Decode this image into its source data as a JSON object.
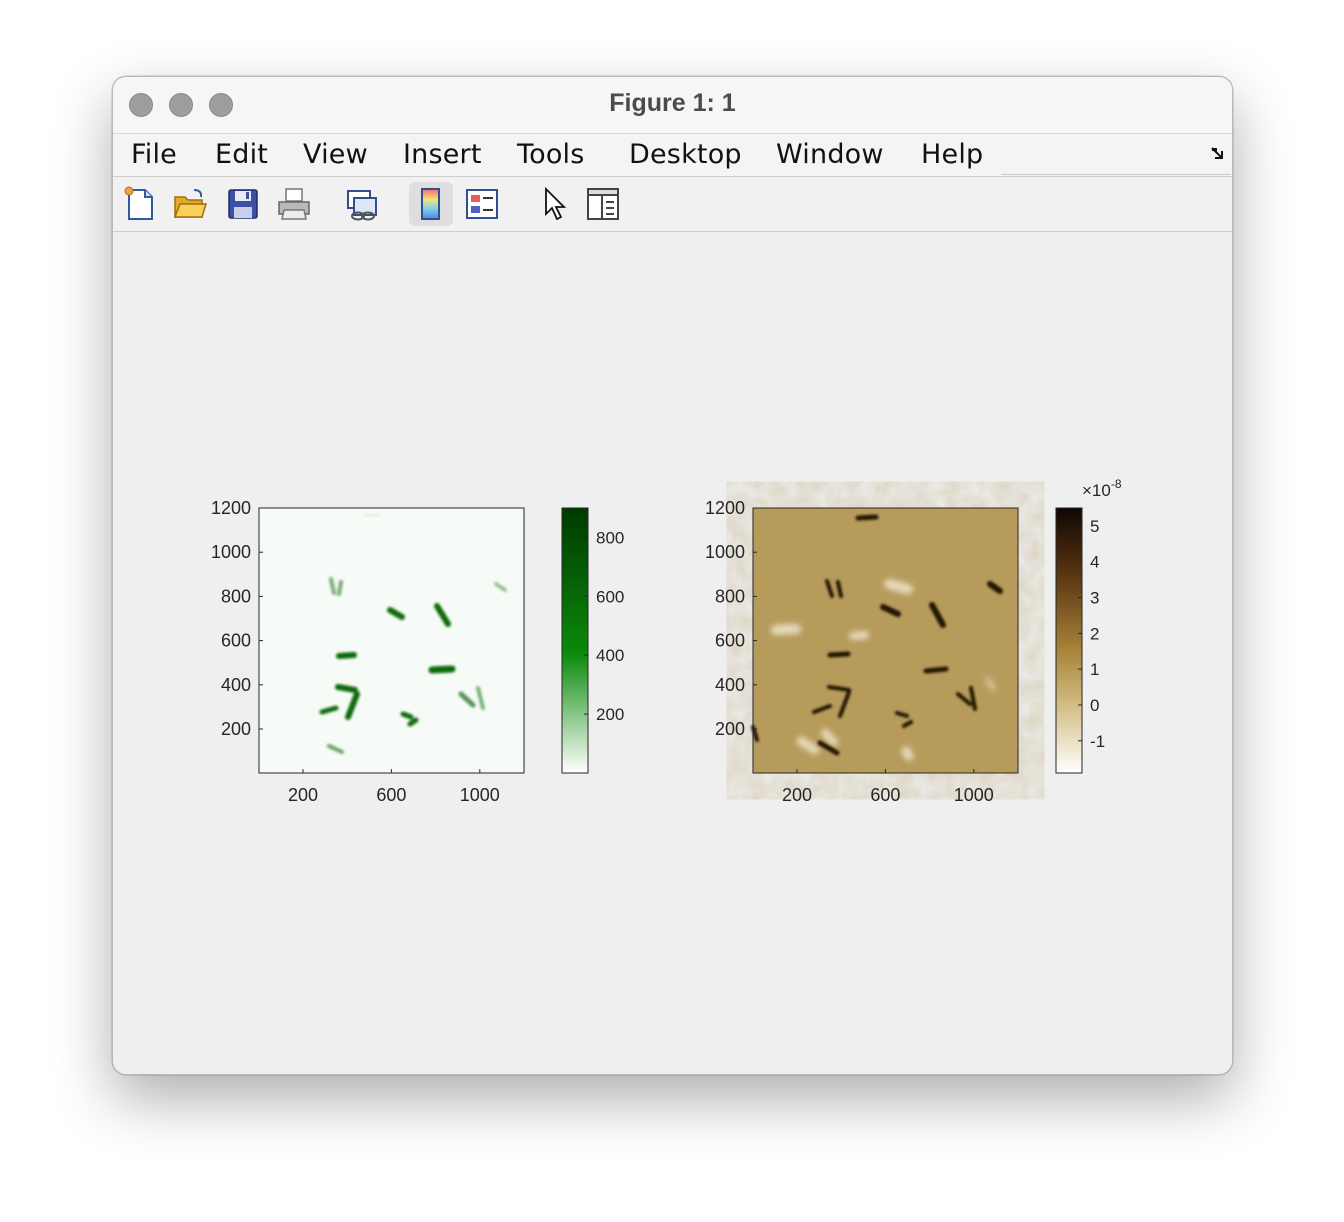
{
  "window": {
    "title": "Figure 1: 1"
  },
  "menu": [
    "File",
    "Edit",
    "View",
    "Insert",
    "Tools",
    "Desktop",
    "Window",
    "Help"
  ],
  "toolbar": [
    "new-figure-icon",
    "open-file-icon",
    "save-icon",
    "print-icon",
    "link-plot-icon",
    "colorbar-icon",
    "legend-icon",
    "edit-plot-pointer-icon",
    "property-inspector-icon"
  ],
  "colors": {
    "green_map_dark": "#003a00",
    "brown_map_dark": "#1a0d05",
    "brown_map_mid": "#b89a53",
    "brown_map_light": "#ffffff"
  },
  "chart_data": [
    {
      "type": "heatmap",
      "colormap": "white-to-green",
      "x_ticks": [
        "200",
        "600",
        "1000"
      ],
      "y_ticks": [
        "1200",
        "1000",
        "800",
        "600",
        "400",
        "200"
      ],
      "xlim": [
        1,
        1200
      ],
      "ylim": [
        1,
        1200
      ],
      "colorbar_ticks": [
        "800",
        "600",
        "400",
        "200"
      ],
      "clim": [
        0,
        900
      ]
    },
    {
      "type": "heatmap",
      "colormap": "white-to-brown",
      "x_ticks": [
        "200",
        "600",
        "1000"
      ],
      "y_ticks": [
        "1200",
        "1000",
        "800",
        "600",
        "400",
        "200"
      ],
      "xlim": [
        1,
        1200
      ],
      "ylim": [
        1,
        1200
      ],
      "colorbar_ticks": [
        "5",
        "4",
        "3",
        "2",
        "1",
        "0",
        "-1"
      ],
      "colorbar_multiplier": "×10",
      "colorbar_exponent": "-8",
      "clim": [
        -1.9,
        5.5
      ]
    }
  ]
}
